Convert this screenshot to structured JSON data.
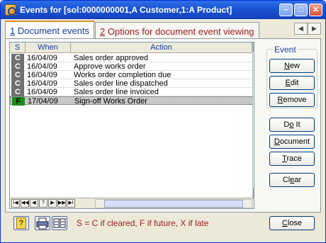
{
  "window": {
    "title": "Events for [sol:0000000001,A Customer,1:A Product]",
    "min_glyph": "–",
    "max_glyph": "□",
    "close_glyph": "✕"
  },
  "tabs": [
    {
      "number": "1",
      "label": "Document events",
      "active": true
    },
    {
      "number": "2",
      "label": "Options for document event viewing",
      "active": false
    }
  ],
  "tab_scroll": {
    "left": "◀",
    "right": "▶"
  },
  "grid": {
    "columns": [
      "S",
      "When",
      "Action"
    ],
    "rows": [
      {
        "s": "C",
        "when": "16/04/09",
        "action": "Sales order approved"
      },
      {
        "s": "C",
        "when": "16/04/09",
        "action": "Approve works order"
      },
      {
        "s": "C",
        "when": "16/04/09",
        "action": "Works order completion due"
      },
      {
        "s": "C",
        "when": "16/04/09",
        "action": "Sales order line dispatched"
      },
      {
        "s": "C",
        "when": "16/04/09",
        "action": "Sales order line invoiced"
      },
      {
        "s": "F",
        "when": "17/04/09",
        "action": "Sign-off Works Order"
      }
    ],
    "selected_row": 5,
    "nav": [
      "I◀",
      "◀◀",
      "◀",
      "?",
      "▶",
      "▶▶",
      "▶I"
    ]
  },
  "event_group": {
    "label": "Event",
    "buttons": {
      "new": "New",
      "edit": "Edit",
      "remove": "Remove"
    }
  },
  "side_buttons": {
    "do_it": "Do It",
    "document": "Document",
    "trace": "Trace",
    "clear": "Clear"
  },
  "bottom": {
    "help_glyph": "?",
    "legend": "S = C if cleared, F if future, X if late",
    "close": "Close"
  },
  "colors": {
    "accent": "#1b3fa0",
    "legend_text": "#a02020",
    "future_status": "#1e8a1e"
  }
}
